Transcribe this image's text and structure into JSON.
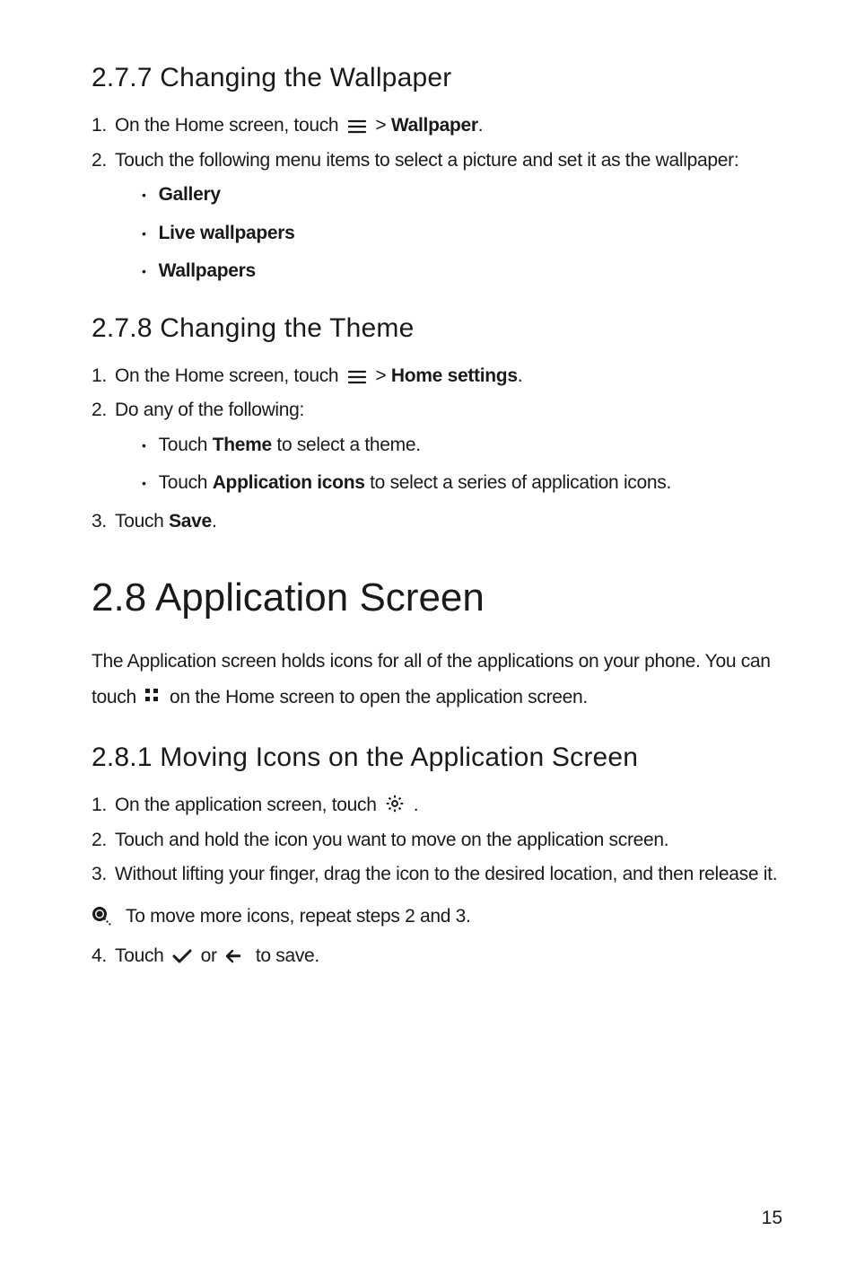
{
  "s277": {
    "heading": "2.7.7  Changing the Wallpaper",
    "step1_pre": "On the Home screen, touch",
    "step1_post": "> ",
    "step1_bold": "Wallpaper",
    "step1_end": ".",
    "step2": "Touch the following menu items to select a picture and set it as the wallpaper:",
    "items": [
      "Gallery",
      "Live wallpapers",
      "Wallpapers"
    ]
  },
  "s278": {
    "heading": "2.7.8  Changing the Theme",
    "step1_pre": "On the Home screen, touch",
    "step1_post": "> ",
    "step1_bold": "Home settings",
    "step1_end": ".",
    "step2": "Do any of the following:",
    "sub1_pre": "Touch ",
    "sub1_bold": "Theme",
    "sub1_post": " to select a theme.",
    "sub2_pre": "Touch ",
    "sub2_bold": "Application icons",
    "sub2_post": " to select a series of application icons.",
    "step3_pre": "Touch ",
    "step3_bold": "Save",
    "step3_end": "."
  },
  "s28": {
    "heading": "2.8  Application Screen",
    "para_pre": "The Application screen holds icons for all of the applications on your phone. You can touch",
    "para_post": "on the Home screen to open the application screen."
  },
  "s281": {
    "heading": "2.8.1  Moving Icons on the Application Screen",
    "step1_pre": "On the application screen, touch",
    "step1_end": ".",
    "step2": "Touch and hold the icon you want to move on the application screen.",
    "step3": "Without lifting your finger, drag the icon to the desired location, and then release it.",
    "note": "To move more icons, repeat steps 2 and 3.",
    "step4_pre": "Touch",
    "step4_mid": "or",
    "step4_end": "to save."
  },
  "page_number": "15"
}
